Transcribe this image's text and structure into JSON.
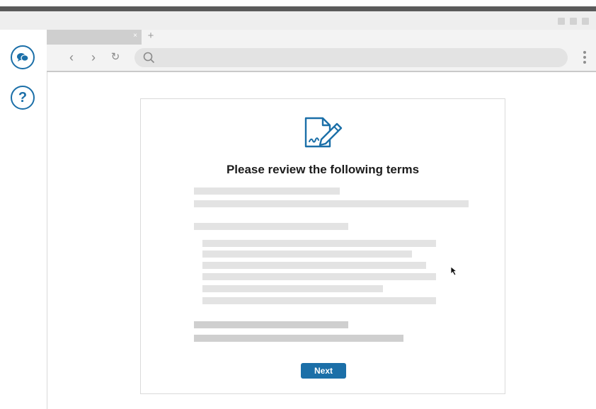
{
  "window": {
    "tab_close": "×",
    "new_tab": "+"
  },
  "nav": {
    "back": "‹",
    "forward": "›",
    "reload": "↻",
    "address_value": ""
  },
  "sidebar": {
    "items": [
      {
        "icon": "chat-bubbles-icon"
      },
      {
        "icon": "help-question-icon",
        "glyph": "?"
      }
    ]
  },
  "card": {
    "icon": "document-signature-icon",
    "title": "Please review the following terms",
    "next_label": "Next"
  },
  "colors": {
    "accent": "#1b6fa8",
    "placeholder_bar": "#e3e3e3"
  }
}
